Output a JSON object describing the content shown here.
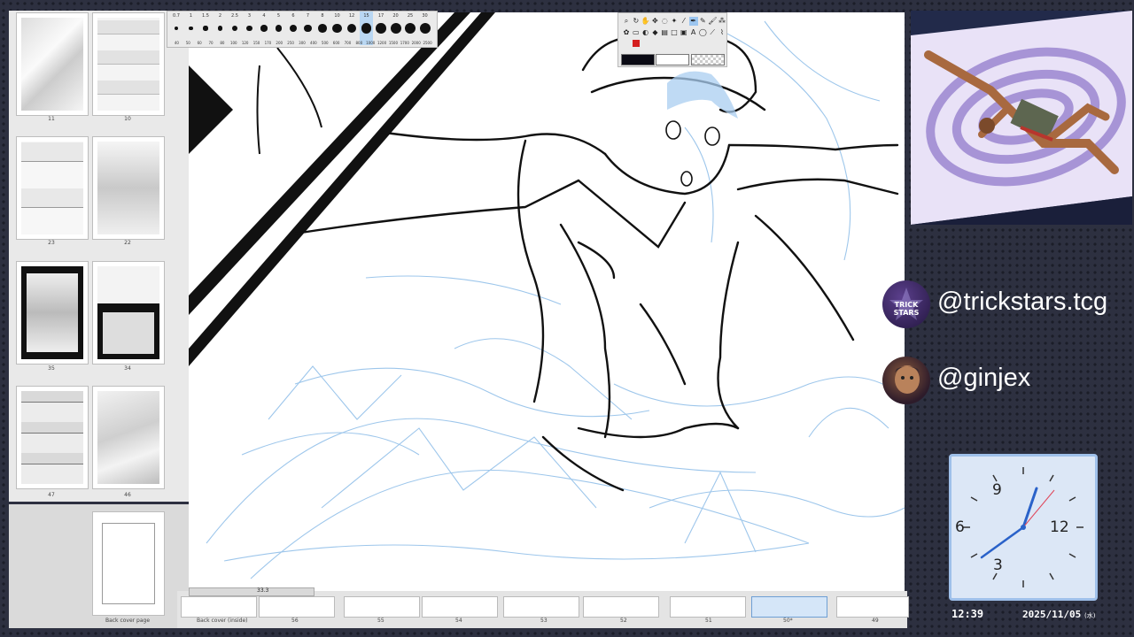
{
  "page_panel": {
    "labels": [
      "11",
      "10",
      "23",
      "22",
      "35",
      "34",
      "47",
      "46",
      "Back cover page"
    ]
  },
  "bottom_strip": {
    "labels": [
      "Back cover (inside)",
      "56",
      "55",
      "54",
      "53",
      "52",
      "51",
      "50*",
      "49"
    ],
    "active_page": "50*"
  },
  "brush_palette": {
    "sizes": [
      "0.7",
      "1",
      "1.5",
      "2",
      "2.5",
      "3",
      "4",
      "5",
      "6",
      "7",
      "8",
      "10",
      "12",
      "15",
      "17",
      "20",
      "25",
      "30"
    ],
    "sizes_bottom": [
      "40",
      "50",
      "60",
      "70",
      "80",
      "100",
      "120",
      "150",
      "170",
      "200",
      "250",
      "300",
      "400",
      "500",
      "600",
      "700",
      "800",
      "1000",
      "1200",
      "1500",
      "1700",
      "2000",
      "2500"
    ],
    "selected_index": 13
  },
  "tool_palette": {
    "tools": [
      "zoom-icon",
      "rotate-icon",
      "hand-icon",
      "move-icon",
      "lasso-icon",
      "wand-icon",
      "eyedropper-icon",
      "pen-icon",
      "pencil-icon",
      "brush-icon",
      "airbrush-icon",
      "decoration-icon",
      "eraser-icon",
      "blend-icon",
      "fill-icon",
      "gradient-icon",
      "figure-icon",
      "frame-icon",
      "text-icon",
      "balloon-icon",
      "ruler-icon",
      "correct-line-icon"
    ],
    "main_color": "#0a0a14",
    "sub_color": "#ffffff",
    "accent_color": "#d41f1f"
  },
  "socials": [
    {
      "handle": "@trickstars.tcg",
      "avatar_label": "TRICK STARS"
    },
    {
      "handle": "@ginjex"
    }
  ],
  "clock": {
    "numerals": [
      "9",
      "12",
      "3",
      "6"
    ],
    "time": "12:39",
    "date": "2025/11/05",
    "weekday": "(水)"
  },
  "canvas": {
    "zoom_readout": "33.3"
  },
  "colors": {
    "background": "#2d3040",
    "clock_border": "#9fc0ea",
    "sketch_blue": "#7fb2e5"
  }
}
